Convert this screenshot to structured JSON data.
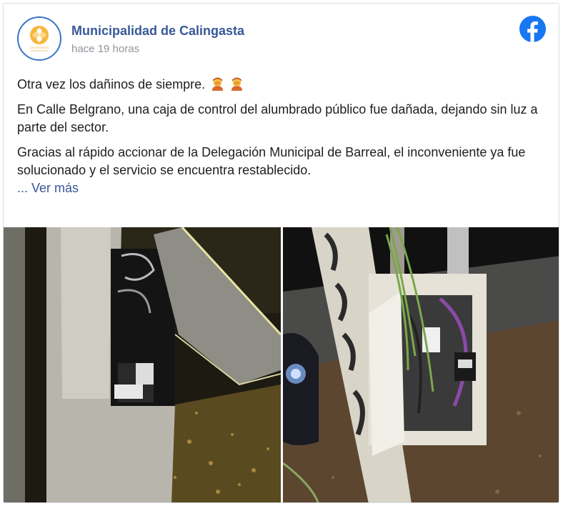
{
  "post": {
    "page_name": "Municipalidad de Calingasta",
    "timestamp": "hace 19 horas",
    "paragraphs": [
      "Otra vez los dañinos de siempre.",
      "En Calle Belgrano, una caja de control del alumbrado público fue dañada, dejando sin luz a parte del sector.",
      "Gracias al rápido accionar de la Delegación Municipal de Barreal, el inconveniente ya fue solucionado y el servicio se encuentra restablecido."
    ],
    "see_more_prefix": "... ",
    "see_more_label": "Ver más",
    "emoji": [
      "person-facepalming-emoji",
      "person-facepalming-emoji"
    ]
  },
  "avatar": {
    "text": "CALINGASTA",
    "sub": "MUNICIPALIDAD"
  },
  "colors": {
    "link": "#385898",
    "facebook_blue": "#1877f2",
    "secondary_text": "#90949c",
    "border": "#dadde1"
  },
  "photos": [
    {
      "name": "damaged-control-box-photo"
    },
    {
      "name": "repaired-control-box-photo"
    }
  ]
}
